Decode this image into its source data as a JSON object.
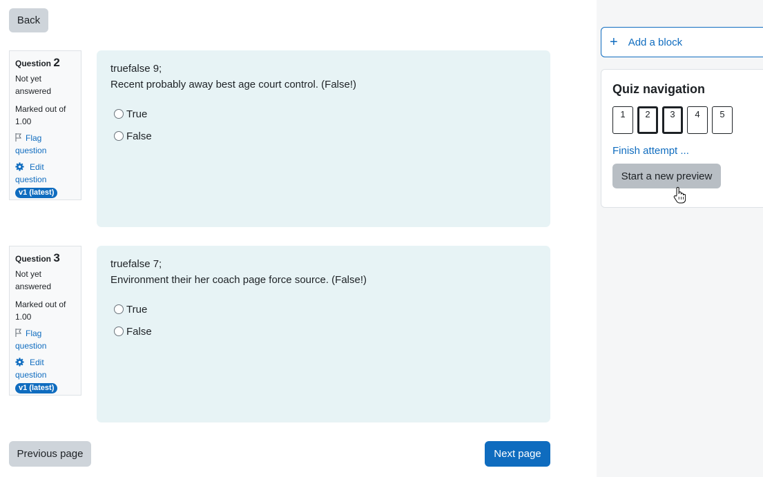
{
  "back_label": "Back",
  "questions": [
    {
      "number_label": "Question",
      "number": "2",
      "state": "Not yet answered",
      "grade": "Marked out of 1.00",
      "flag_label": "Flag question",
      "edit_label": "Edit question",
      "version": "v1 (latest)",
      "name": "truefalse 9;",
      "text": "Recent probably away best age court control. (False!)",
      "options": [
        "True",
        "False"
      ]
    },
    {
      "number_label": "Question",
      "number": "3",
      "state": "Not yet answered",
      "grade": "Marked out of 1.00",
      "flag_label": "Flag question",
      "edit_label": "Edit question",
      "version": "v1 (latest)",
      "name": "truefalse 7;",
      "text": "Environment their her coach page force source. (False!)",
      "options": [
        "True",
        "False"
      ]
    }
  ],
  "prev_label": "Previous page",
  "next_label": "Next page",
  "add_block": {
    "icon": "plus-icon",
    "label": "Add a block"
  },
  "quiz_nav": {
    "title": "Quiz navigation",
    "buttons": [
      "1",
      "2",
      "3",
      "4",
      "5"
    ],
    "current": [
      "2",
      "3"
    ],
    "finish_label": "Finish attempt ...",
    "new_preview_label": "Start a new preview"
  },
  "colors": {
    "primary": "#0f6cbf",
    "question_bg": "#e7f3f5",
    "drawer_bg": "#f5f6f7"
  }
}
